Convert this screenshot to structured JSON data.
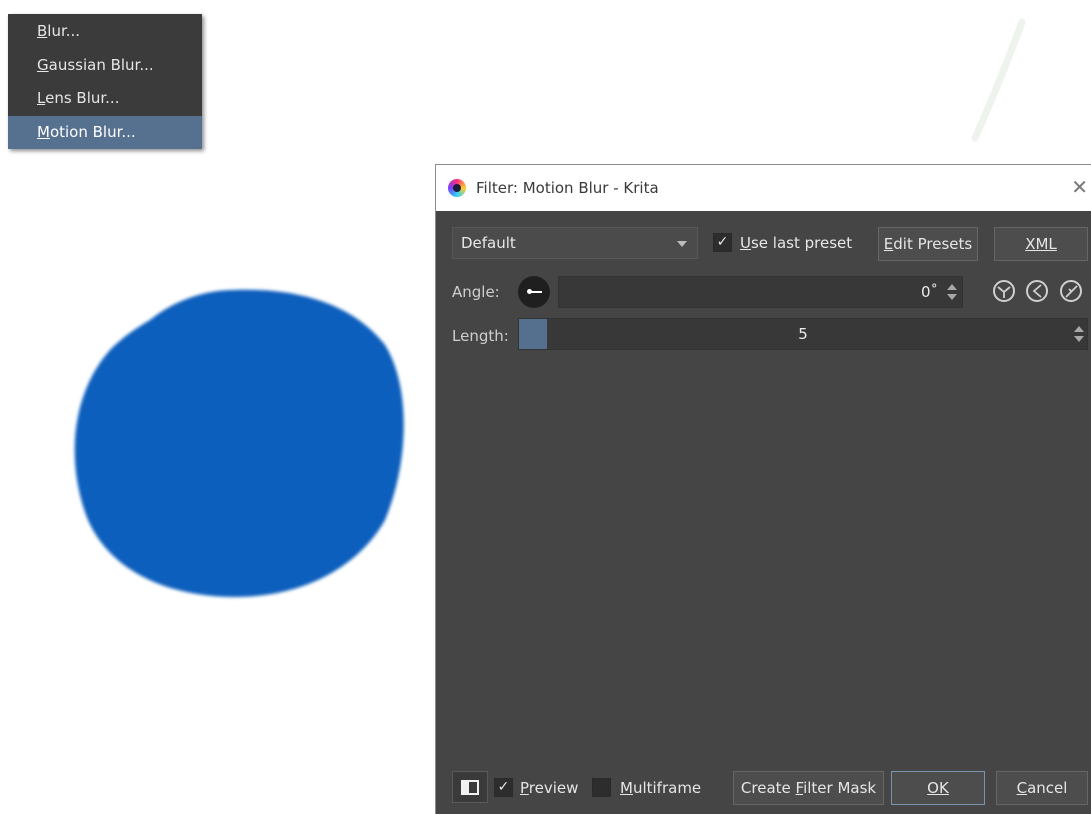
{
  "menu": {
    "items": [
      {
        "label": "Blur...",
        "mnemonic": "B",
        "rest": "lur...",
        "active": false
      },
      {
        "label": "Gaussian Blur...",
        "mnemonic": "G",
        "rest": "aussian Blur...",
        "active": false
      },
      {
        "label": "Lens Blur...",
        "mnemonic": "L",
        "rest": "ens Blur...",
        "active": false
      },
      {
        "label": "Motion Blur...",
        "mnemonic": "M",
        "rest": "otion Blur...",
        "active": true
      }
    ]
  },
  "dialog": {
    "title": "Filter: Motion Blur - Krita",
    "preset": {
      "selected": "Default"
    },
    "use_last_preset": {
      "checked": true,
      "mnemonic": "U",
      "rest": "se last preset"
    },
    "edit_presets": {
      "mnemonic": "E",
      "rest": "dit Presets"
    },
    "xml": {
      "mnemonic": "X",
      "rest": "ML"
    },
    "angle": {
      "label": "Angle:",
      "value": "0˚"
    },
    "length": {
      "label": "Length:",
      "value": "5",
      "fill_fraction": 0.05
    },
    "preview": {
      "checked": true,
      "mnemonic": "P",
      "rest": "review"
    },
    "multiframe": {
      "checked": false,
      "mnemonic": "M",
      "rest": "ultiframe"
    },
    "create_filter_mask": {
      "before": "Create ",
      "mnemonic": "F",
      "rest": "ilter Mask"
    },
    "ok": {
      "mnemonic": "O",
      "rest": "K"
    },
    "cancel": {
      "mnemonic": "C",
      "rest": "ancel"
    }
  },
  "colors": {
    "blob": "#0a5fbd",
    "menu_bg": "#3b3b3b",
    "menu_active": "#56708f",
    "dialog_bg": "#454545",
    "accent": "#55708e"
  },
  "icons": {
    "app": "krita-icon",
    "close": "close-icon",
    "angle_dial": "angle-dial-icon",
    "rotate_options": [
      "angle-snap-icon",
      "angle-reset-icon",
      "angle-direction-icon"
    ],
    "split_view": "split-preview-icon"
  }
}
